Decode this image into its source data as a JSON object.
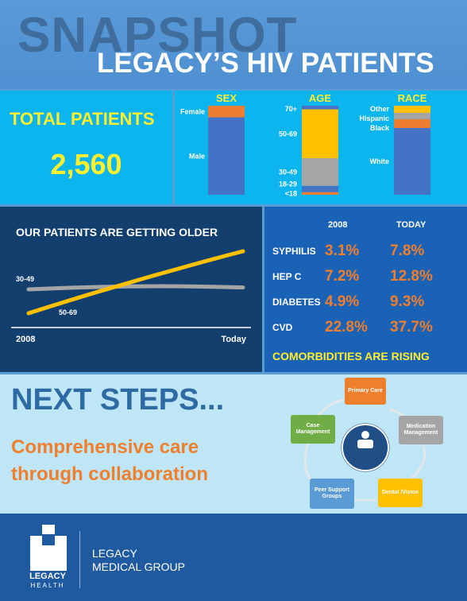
{
  "header": {
    "snapshot": "SNAPSHOT",
    "subtitle": "LEGACY’S HIV PATIENTS"
  },
  "total": {
    "label": "TOTAL PATIENTS",
    "value": "2,560"
  },
  "demographics": {
    "sex": {
      "title": "SEX",
      "segments": [
        {
          "label": "Male",
          "share": 0.87,
          "color": "#4472c4"
        },
        {
          "label": "Female",
          "share": 0.13,
          "color": "#ed7d31"
        }
      ]
    },
    "age": {
      "title": "AGE",
      "segments": [
        {
          "label": "<18",
          "share": 0.03,
          "color": "#ed7d31"
        },
        {
          "label": "18-29",
          "share": 0.07,
          "color": "#4472c4"
        },
        {
          "label": "30-49",
          "share": 0.31,
          "color": "#a5a5a5"
        },
        {
          "label": "50-69",
          "share": 0.55,
          "color": "#ffc000"
        },
        {
          "label": "70+",
          "share": 0.04,
          "color": "#4472c4"
        }
      ]
    },
    "race": {
      "title": "RACE",
      "segments": [
        {
          "label": "White",
          "share": 0.75,
          "color": "#4472c4"
        },
        {
          "label": "Black",
          "share": 0.1,
          "color": "#ed7d31"
        },
        {
          "label": "Hispanic",
          "share": 0.07,
          "color": "#a5a5a5"
        },
        {
          "label": "Other",
          "share": 0.08,
          "color": "#ffc000"
        }
      ]
    }
  },
  "older": {
    "title": "OUR PATIENTS ARE GETTING OLDER",
    "x_start": "2008",
    "x_end": "Today",
    "lines": [
      {
        "label": "30-49",
        "color": "#a5a5a5",
        "start": 0.55,
        "end": 0.57
      },
      {
        "label": "50-69",
        "color": "#ffc000",
        "start": 0.3,
        "end": 0.95
      }
    ]
  },
  "comorbidities": {
    "col_2008": "2008",
    "col_today": "TODAY",
    "rows": [
      {
        "name": "SYPHILIS",
        "v2008": "3.1%",
        "today": "7.8%"
      },
      {
        "name": "HEP C",
        "v2008": "7.2%",
        "today": "12.8%"
      },
      {
        "name": "DIABETES",
        "v2008": "4.9%",
        "today": "9.3%"
      },
      {
        "name": "CVD",
        "v2008": "22.8%",
        "today": "37.7%"
      }
    ],
    "title": "COMORBIDITIES ARE RISING"
  },
  "next_steps": {
    "title": "NEXT STEPS...",
    "line1": "Comprehensive care",
    "line2": "through collaboration",
    "cycle": [
      {
        "label": "Primary Care",
        "color": "#f07f2d"
      },
      {
        "label": "Medication Management",
        "color": "#a5a5a5"
      },
      {
        "label": "Dental /Vision",
        "color": "#ffc000"
      },
      {
        "label": "Peer Support Groups",
        "color": "#5b9bd5"
      },
      {
        "label": "Case Management",
        "color": "#70ad47"
      }
    ]
  },
  "footer": {
    "org_line1": "LEGACY",
    "org_line2": "MEDICAL GROUP",
    "logo_line1": "LEGACY",
    "logo_line2": "HEALTH"
  }
}
